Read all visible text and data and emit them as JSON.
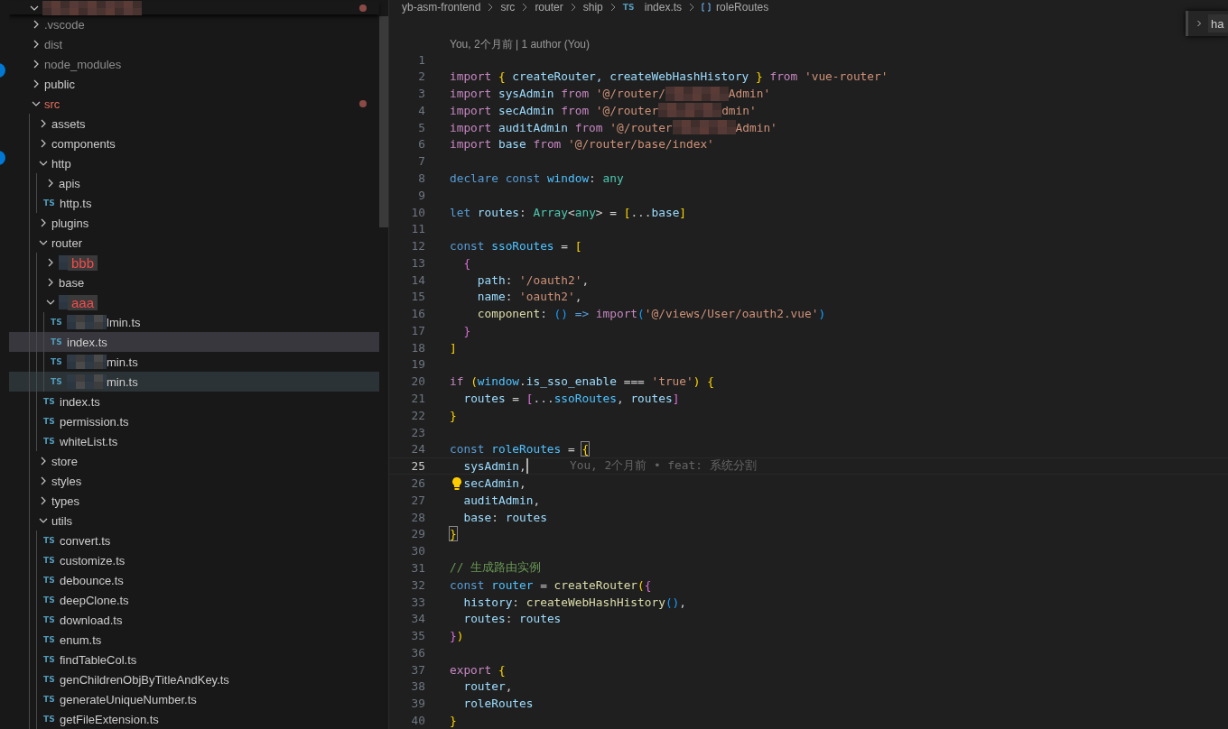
{
  "explorer": {
    "root": {
      "modified": true,
      "expanded": true
    },
    "tree": [
      {
        "name": ".vscode",
        "kind": "folder",
        "expanded": false,
        "modified": false,
        "ignored": true,
        "selected": false,
        "hovered": false,
        "redacted": false,
        "marked": false
      },
      {
        "name": "dist",
        "kind": "folder",
        "expanded": false,
        "modified": false,
        "ignored": true,
        "selected": false,
        "hovered": false,
        "redacted": false,
        "marked": false
      },
      {
        "name": "node_modules",
        "kind": "folder",
        "expanded": false,
        "modified": false,
        "ignored": true,
        "selected": false,
        "hovered": false,
        "redacted": false,
        "marked": false
      },
      {
        "name": "public",
        "kind": "folder",
        "expanded": false,
        "modified": false,
        "ignored": false,
        "selected": false,
        "hovered": false,
        "redacted": false,
        "marked": false
      },
      {
        "name": "src",
        "kind": "folder",
        "expanded": true,
        "modified": true,
        "ignored": false,
        "selected": false,
        "hovered": false,
        "redacted": false,
        "marked": false,
        "children": [
          {
            "name": "assets",
            "kind": "folder",
            "expanded": false,
            "modified": false,
            "ignored": false,
            "selected": false,
            "hovered": false,
            "redacted": false,
            "marked": false
          },
          {
            "name": "components",
            "kind": "folder",
            "expanded": false,
            "modified": false,
            "ignored": false,
            "selected": false,
            "hovered": false,
            "redacted": false,
            "marked": false
          },
          {
            "name": "http",
            "kind": "folder",
            "expanded": true,
            "modified": false,
            "ignored": false,
            "selected": false,
            "hovered": false,
            "redacted": false,
            "marked": false,
            "children": [
              {
                "name": "apis",
                "kind": "folder",
                "expanded": false,
                "modified": false,
                "ignored": false,
                "selected": false,
                "hovered": false,
                "redacted": false,
                "marked": false
              },
              {
                "name": "http.ts",
                "kind": "file",
                "icon": "TS",
                "modified": false,
                "ignored": false,
                "selected": false,
                "hovered": false,
                "redacted": false,
                "marked": false
              }
            ]
          },
          {
            "name": "plugins",
            "kind": "folder",
            "expanded": false,
            "modified": false,
            "ignored": false,
            "selected": false,
            "hovered": false,
            "redacted": false,
            "marked": false
          },
          {
            "name": "router",
            "kind": "folder",
            "expanded": true,
            "modified": false,
            "ignored": false,
            "selected": false,
            "hovered": false,
            "redacted": false,
            "marked": false,
            "children": [
              {
                "name": "bbb",
                "kind": "folder",
                "expanded": false,
                "modified": false,
                "ignored": false,
                "selected": false,
                "hovered": false,
                "redacted": true,
                "marked": true
              },
              {
                "name": "base",
                "kind": "folder",
                "expanded": false,
                "modified": false,
                "ignored": false,
                "selected": false,
                "hovered": false,
                "redacted": false,
                "marked": false
              },
              {
                "name": "aaa",
                "kind": "folder",
                "expanded": true,
                "modified": false,
                "ignored": false,
                "selected": false,
                "hovered": false,
                "redacted": true,
                "marked": true,
                "children": [
                  {
                    "name": "lmin.ts",
                    "kind": "file",
                    "icon": "TS",
                    "modified": false,
                    "ignored": false,
                    "selected": false,
                    "hovered": false,
                    "redacted": true,
                    "marked": false
                  },
                  {
                    "name": "index.ts",
                    "kind": "file",
                    "icon": "TS",
                    "modified": false,
                    "ignored": false,
                    "selected": true,
                    "hovered": false,
                    "redacted": false,
                    "marked": false
                  },
                  {
                    "name": "min.ts",
                    "kind": "file",
                    "icon": "TS",
                    "modified": false,
                    "ignored": false,
                    "selected": false,
                    "hovered": false,
                    "redacted": true,
                    "marked": false
                  },
                  {
                    "name": "min.ts",
                    "kind": "file",
                    "icon": "TS",
                    "modified": false,
                    "ignored": false,
                    "selected": false,
                    "hovered": true,
                    "redacted": true,
                    "marked": false
                  }
                ]
              },
              {
                "name": "index.ts",
                "kind": "file",
                "icon": "TS",
                "modified": false,
                "ignored": false,
                "selected": false,
                "hovered": false,
                "redacted": false,
                "marked": false
              },
              {
                "name": "permission.ts",
                "kind": "file",
                "icon": "TS",
                "modified": false,
                "ignored": false,
                "selected": false,
                "hovered": false,
                "redacted": false,
                "marked": false
              },
              {
                "name": "whiteList.ts",
                "kind": "file",
                "icon": "TS",
                "modified": false,
                "ignored": false,
                "selected": false,
                "hovered": false,
                "redacted": false,
                "marked": false
              }
            ]
          },
          {
            "name": "store",
            "kind": "folder",
            "expanded": false,
            "modified": false,
            "ignored": false,
            "selected": false,
            "hovered": false,
            "redacted": false,
            "marked": false
          },
          {
            "name": "styles",
            "kind": "folder",
            "expanded": false,
            "modified": false,
            "ignored": false,
            "selected": false,
            "hovered": false,
            "redacted": false,
            "marked": false
          },
          {
            "name": "types",
            "kind": "folder",
            "expanded": false,
            "modified": false,
            "ignored": false,
            "selected": false,
            "hovered": false,
            "redacted": false,
            "marked": false
          },
          {
            "name": "utils",
            "kind": "folder",
            "expanded": true,
            "modified": false,
            "ignored": false,
            "selected": false,
            "hovered": false,
            "redacted": false,
            "marked": false,
            "children": [
              {
                "name": "convert.ts",
                "kind": "file",
                "icon": "TS",
                "modified": false,
                "ignored": false,
                "selected": false,
                "hovered": false,
                "redacted": false,
                "marked": false
              },
              {
                "name": "customize.ts",
                "kind": "file",
                "icon": "TS",
                "modified": false,
                "ignored": false,
                "selected": false,
                "hovered": false,
                "redacted": false,
                "marked": false
              },
              {
                "name": "debounce.ts",
                "kind": "file",
                "icon": "TS",
                "modified": false,
                "ignored": false,
                "selected": false,
                "hovered": false,
                "redacted": false,
                "marked": false
              },
              {
                "name": "deepClone.ts",
                "kind": "file",
                "icon": "TS",
                "modified": false,
                "ignored": false,
                "selected": false,
                "hovered": false,
                "redacted": false,
                "marked": false
              },
              {
                "name": "download.ts",
                "kind": "file",
                "icon": "TS",
                "modified": false,
                "ignored": false,
                "selected": false,
                "hovered": false,
                "redacted": false,
                "marked": false
              },
              {
                "name": "enum.ts",
                "kind": "file",
                "icon": "TS",
                "modified": false,
                "ignored": false,
                "selected": false,
                "hovered": false,
                "redacted": false,
                "marked": false
              },
              {
                "name": "findTableCol.ts",
                "kind": "file",
                "icon": "TS",
                "modified": false,
                "ignored": false,
                "selected": false,
                "hovered": false,
                "redacted": false,
                "marked": false
              },
              {
                "name": "genChildrenObjByTitleAndKey.ts",
                "kind": "file",
                "icon": "TS",
                "modified": false,
                "ignored": false,
                "selected": false,
                "hovered": false,
                "redacted": false,
                "marked": false
              },
              {
                "name": "generateUniqueNumber.ts",
                "kind": "file",
                "icon": "TS",
                "modified": false,
                "ignored": false,
                "selected": false,
                "hovered": false,
                "redacted": false,
                "marked": false
              },
              {
                "name": "getFileExtension.ts",
                "kind": "file",
                "icon": "TS",
                "modified": false,
                "ignored": false,
                "selected": false,
                "hovered": false,
                "redacted": false,
                "marked": false
              }
            ]
          }
        ]
      }
    ]
  },
  "breadcrumb": [
    {
      "text": "yb-asm-frontend",
      "kind": "folder"
    },
    {
      "text": "src",
      "kind": "folder"
    },
    {
      "text": "router",
      "kind": "folder"
    },
    {
      "text": "ship",
      "kind": "folder"
    },
    {
      "text": "index.ts",
      "kind": "file",
      "icon": "TS"
    },
    {
      "text": "roleRoutes",
      "kind": "symbol"
    }
  ],
  "find": {
    "value": "ha"
  },
  "editor": {
    "codelens": "You, 2个月前 | 1 author (You)",
    "lines": [
      {
        "number": "1",
        "current": false,
        "lightbulb": false
      },
      {
        "number": "2",
        "current": false,
        "lightbulb": false,
        "tokens": [
          {
            "text": "import ",
            "kind": "keyword"
          },
          {
            "text": "{",
            "kind": "bracket1"
          },
          {
            "text": " createRouter, createWebHashHistory ",
            "kind": "variable"
          },
          {
            "text": "}",
            "kind": "bracket1"
          },
          {
            "text": " from ",
            "kind": "keyword"
          },
          {
            "text": "'vue-router'",
            "kind": "string"
          }
        ]
      },
      {
        "number": "3",
        "current": false,
        "lightbulb": false,
        "tokens": [
          {
            "text": "import ",
            "kind": "keyword"
          },
          {
            "text": "sysAdmin ",
            "kind": "variable"
          },
          {
            "text": "from ",
            "kind": "keyword"
          },
          {
            "text": "'@/router/",
            "kind": "string"
          },
          {
            "kind": "mosaic"
          },
          {
            "text": "Admin'",
            "kind": "string"
          }
        ]
      },
      {
        "number": "4",
        "current": false,
        "lightbulb": false,
        "tokens": [
          {
            "text": "import ",
            "kind": "keyword"
          },
          {
            "text": "secAdmin ",
            "kind": "variable"
          },
          {
            "text": "from ",
            "kind": "keyword"
          },
          {
            "text": "'@/router",
            "kind": "string"
          },
          {
            "kind": "mosaic"
          },
          {
            "text": "dmin'",
            "kind": "string"
          }
        ]
      },
      {
        "number": "5",
        "current": false,
        "lightbulb": false,
        "tokens": [
          {
            "text": "import ",
            "kind": "keyword"
          },
          {
            "text": "auditAdmin ",
            "kind": "variable"
          },
          {
            "text": "from ",
            "kind": "keyword"
          },
          {
            "text": "'@/router",
            "kind": "string"
          },
          {
            "kind": "mosaic"
          },
          {
            "text": "Admin'",
            "kind": "string"
          }
        ]
      },
      {
        "number": "6",
        "current": false,
        "lightbulb": false,
        "tokens": [
          {
            "text": "import ",
            "kind": "keyword"
          },
          {
            "text": "base ",
            "kind": "variable"
          },
          {
            "text": "from ",
            "kind": "keyword"
          },
          {
            "text": "'@/router/base/index'",
            "kind": "string"
          }
        ]
      },
      {
        "number": "7",
        "current": false,
        "lightbulb": false
      },
      {
        "number": "8",
        "current": false,
        "lightbulb": false,
        "tokens": [
          {
            "text": "declare const ",
            "kind": "storage"
          },
          {
            "text": "window",
            "kind": "constant"
          },
          {
            "text": ": ",
            "kind": "punctuation"
          },
          {
            "text": "any",
            "kind": "type"
          }
        ]
      },
      {
        "number": "9",
        "current": false,
        "lightbulb": false
      },
      {
        "number": "10",
        "current": false,
        "lightbulb": false,
        "tokens": [
          {
            "text": "let ",
            "kind": "storage"
          },
          {
            "text": "routes",
            "kind": "variable"
          },
          {
            "text": ": ",
            "kind": "punctuation"
          },
          {
            "text": "Array",
            "kind": "type"
          },
          {
            "text": "<",
            "kind": "punctuation"
          },
          {
            "text": "any",
            "kind": "type"
          },
          {
            "text": "> = ",
            "kind": "punctuation"
          },
          {
            "text": "[",
            "kind": "bracket1"
          },
          {
            "text": "...",
            "kind": "punctuation"
          },
          {
            "text": "base",
            "kind": "variable"
          },
          {
            "text": "]",
            "kind": "bracket1"
          }
        ]
      },
      {
        "number": "11",
        "current": false,
        "lightbulb": false
      },
      {
        "number": "12",
        "current": false,
        "lightbulb": false,
        "tokens": [
          {
            "text": "const ",
            "kind": "storage"
          },
          {
            "text": "ssoRoutes",
            "kind": "constant"
          },
          {
            "text": " = ",
            "kind": "punctuation"
          },
          {
            "text": "[",
            "kind": "bracket1"
          }
        ]
      },
      {
        "number": "13",
        "current": false,
        "lightbulb": false,
        "tokens": [
          {
            "text": "  {",
            "kind": "bracket2"
          }
        ]
      },
      {
        "number": "14",
        "current": false,
        "lightbulb": false,
        "tokens": [
          {
            "text": "    path",
            "kind": "variable"
          },
          {
            "text": ": ",
            "kind": "punctuation"
          },
          {
            "text": "'/oauth2'",
            "kind": "string"
          },
          {
            "text": ",",
            "kind": "punctuation"
          }
        ]
      },
      {
        "number": "15",
        "current": false,
        "lightbulb": false,
        "tokens": [
          {
            "text": "    name",
            "kind": "variable"
          },
          {
            "text": ": ",
            "kind": "punctuation"
          },
          {
            "text": "'oauth2'",
            "kind": "string"
          },
          {
            "text": ",",
            "kind": "punctuation"
          }
        ]
      },
      {
        "number": "16",
        "current": false,
        "lightbulb": false,
        "tokens": [
          {
            "text": "    component",
            "kind": "function"
          },
          {
            "text": ": ",
            "kind": "punctuation"
          },
          {
            "text": "()",
            "kind": "bracket3"
          },
          {
            "text": " => ",
            "kind": "storage"
          },
          {
            "text": "import",
            "kind": "keyword"
          },
          {
            "text": "(",
            "kind": "bracket3"
          },
          {
            "text": "'@/views/User/oauth2.vue'",
            "kind": "string"
          },
          {
            "text": ")",
            "kind": "bracket3"
          }
        ]
      },
      {
        "number": "17",
        "current": false,
        "lightbulb": false,
        "tokens": [
          {
            "text": "  }",
            "kind": "bracket2"
          }
        ]
      },
      {
        "number": "18",
        "current": false,
        "lightbulb": false,
        "tokens": [
          {
            "text": "]",
            "kind": "bracket1"
          }
        ]
      },
      {
        "number": "19",
        "current": false,
        "lightbulb": false
      },
      {
        "number": "20",
        "current": false,
        "lightbulb": false,
        "tokens": [
          {
            "text": "if ",
            "kind": "keyword"
          },
          {
            "text": "(",
            "kind": "bracket1"
          },
          {
            "text": "window",
            "kind": "constant"
          },
          {
            "text": ".",
            "kind": "punctuation"
          },
          {
            "text": "is_sso_enable",
            "kind": "variable"
          },
          {
            "text": " === ",
            "kind": "punctuation"
          },
          {
            "text": "'true'",
            "kind": "string"
          },
          {
            "text": ")",
            "kind": "bracket1"
          },
          {
            "text": " {",
            "kind": "bracket1"
          }
        ]
      },
      {
        "number": "21",
        "current": false,
        "lightbulb": false,
        "tokens": [
          {
            "text": "  routes",
            "kind": "variable"
          },
          {
            "text": " = ",
            "kind": "punctuation"
          },
          {
            "text": "[",
            "kind": "bracket2"
          },
          {
            "text": "...",
            "kind": "punctuation"
          },
          {
            "text": "ssoRoutes",
            "kind": "constant"
          },
          {
            "text": ", ",
            "kind": "punctuation"
          },
          {
            "text": "routes",
            "kind": "variable"
          },
          {
            "text": "]",
            "kind": "bracket2"
          }
        ]
      },
      {
        "number": "22",
        "current": false,
        "lightbulb": false,
        "tokens": [
          {
            "text": "}",
            "kind": "bracket1"
          }
        ]
      },
      {
        "number": "23",
        "current": false,
        "lightbulb": false
      },
      {
        "number": "24",
        "current": false,
        "lightbulb": false,
        "tokens": [
          {
            "text": "const ",
            "kind": "storage"
          },
          {
            "text": "roleRoutes",
            "kind": "constant"
          },
          {
            "text": " = ",
            "kind": "punctuation"
          },
          {
            "text": "{",
            "kind": "matched-bracket"
          }
        ]
      },
      {
        "number": "25",
        "current": true,
        "lightbulb": false,
        "tokens": [
          {
            "text": "  sysAdmin",
            "kind": "variable"
          },
          {
            "text": ",",
            "kind": "punctuation"
          }
        ],
        "blame": "You, 2个月前 • feat: 系统分割"
      },
      {
        "number": "26",
        "current": false,
        "lightbulb": true,
        "tokens": [
          {
            "text": "  secAdmin",
            "kind": "variable"
          },
          {
            "text": ",",
            "kind": "punctuation"
          }
        ]
      },
      {
        "number": "27",
        "current": false,
        "lightbulb": false,
        "tokens": [
          {
            "text": "  auditAdmin",
            "kind": "variable"
          },
          {
            "text": ",",
            "kind": "punctuation"
          }
        ]
      },
      {
        "number": "28",
        "current": false,
        "lightbulb": false,
        "tokens": [
          {
            "text": "  base",
            "kind": "variable"
          },
          {
            "text": ": ",
            "kind": "punctuation"
          },
          {
            "text": "routes",
            "kind": "variable"
          }
        ]
      },
      {
        "number": "29",
        "current": false,
        "lightbulb": false,
        "tokens": [
          {
            "text": "}",
            "kind": "matched-bracket"
          }
        ]
      },
      {
        "number": "30",
        "current": false,
        "lightbulb": false
      },
      {
        "number": "31",
        "current": false,
        "lightbulb": false,
        "tokens": [
          {
            "text": "// 生成路由实例",
            "kind": "comment"
          }
        ]
      },
      {
        "number": "32",
        "current": false,
        "lightbulb": false,
        "tokens": [
          {
            "text": "const ",
            "kind": "storage"
          },
          {
            "text": "router",
            "kind": "constant"
          },
          {
            "text": " = ",
            "kind": "punctuation"
          },
          {
            "text": "createRouter",
            "kind": "function"
          },
          {
            "text": "(",
            "kind": "bracket1"
          },
          {
            "text": "{",
            "kind": "bracket2"
          }
        ]
      },
      {
        "number": "33",
        "current": false,
        "lightbulb": false,
        "tokens": [
          {
            "text": "  history",
            "kind": "variable"
          },
          {
            "text": ": ",
            "kind": "punctuation"
          },
          {
            "text": "createWebHashHistory",
            "kind": "function"
          },
          {
            "text": "()",
            "kind": "bracket3"
          },
          {
            "text": ",",
            "kind": "punctuation"
          }
        ]
      },
      {
        "number": "34",
        "current": false,
        "lightbulb": false,
        "tokens": [
          {
            "text": "  routes",
            "kind": "variable"
          },
          {
            "text": ": ",
            "kind": "punctuation"
          },
          {
            "text": "routes",
            "kind": "variable"
          }
        ]
      },
      {
        "number": "35",
        "current": false,
        "lightbulb": false,
        "tokens": [
          {
            "text": "}",
            "kind": "bracket2"
          },
          {
            "text": ")",
            "kind": "bracket1"
          }
        ]
      },
      {
        "number": "36",
        "current": false,
        "lightbulb": false
      },
      {
        "number": "37",
        "current": false,
        "lightbulb": false,
        "tokens": [
          {
            "text": "export ",
            "kind": "keyword"
          },
          {
            "text": "{",
            "kind": "bracket1"
          }
        ]
      },
      {
        "number": "38",
        "current": false,
        "lightbulb": false,
        "tokens": [
          {
            "text": "  router",
            "kind": "variable"
          },
          {
            "text": ",",
            "kind": "punctuation"
          }
        ]
      },
      {
        "number": "39",
        "current": false,
        "lightbulb": false,
        "tokens": [
          {
            "text": "  roleRoutes",
            "kind": "variable"
          }
        ]
      },
      {
        "number": "40",
        "current": false,
        "lightbulb": false,
        "tokens": [
          {
            "text": "}",
            "kind": "bracket1"
          }
        ]
      }
    ]
  }
}
